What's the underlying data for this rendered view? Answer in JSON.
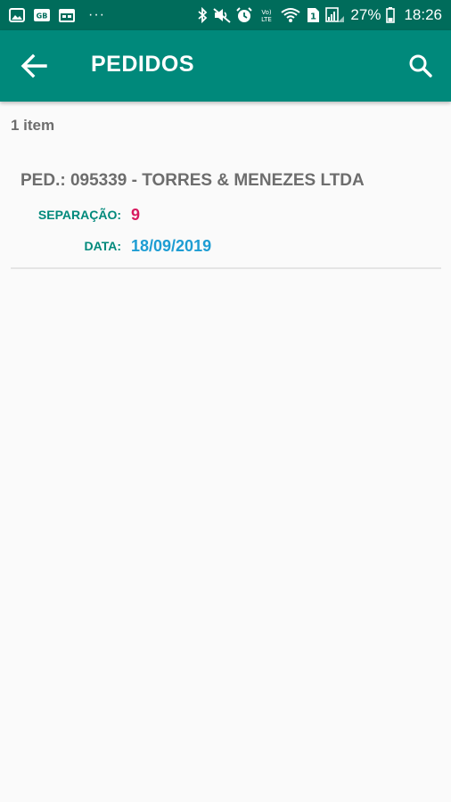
{
  "status_bar": {
    "battery_percent": "27%",
    "time": "18:26",
    "left_icons": [
      "image-icon",
      "gb-icon",
      "calendar-icon",
      "more-dots-icon"
    ],
    "right_icons": [
      "bluetooth-icon",
      "mute-icon",
      "alarm-icon",
      "volte-icon",
      "wifi-icon",
      "sim-icon",
      "signal-icon",
      "battery-icon"
    ],
    "dots": "···",
    "volte_label": "Vo)\nLTE",
    "sim_label": "1"
  },
  "app_bar": {
    "title": "PEDIDOS",
    "back_icon": "arrow-back-icon",
    "search_icon": "search-icon",
    "color": "#00897b"
  },
  "list": {
    "count_label": "1 item",
    "orders": [
      {
        "title": "PED.: 095339 - TORRES & MENEZES LTDA",
        "separation_label": "SEPARAÇÃO:",
        "separation_value": "9",
        "date_label": "DATA:",
        "date_value": "18/09/2019"
      }
    ]
  },
  "colors": {
    "status_bar": "#006c5b",
    "accent": "#00897b",
    "separation_value": "#d81b60",
    "date_value": "#1e9dd3",
    "text_muted": "#6d6d6d"
  }
}
